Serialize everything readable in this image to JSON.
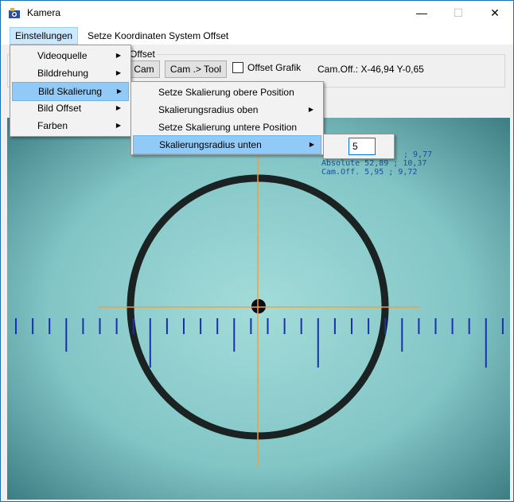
{
  "window": {
    "title": "Kamera",
    "minimize": "—",
    "maximize": "☐",
    "close": "✕"
  },
  "menubar": {
    "items": [
      {
        "label": "Einstellungen"
      },
      {
        "label": "Setze Koordinaten System Offset"
      }
    ]
  },
  "toolbar": {
    "group_label": "Offset",
    "cam_button": "Cam",
    "cam_tool_button": "Cam .> Tool",
    "offset_grafik_label": "Offset Grafik",
    "offset_grafik_checked": false,
    "cam_offset_text": "Cam.Off.: X-46,94 Y-0,65"
  },
  "dropdown_main": {
    "items": [
      {
        "label": "Videoquelle",
        "has_submenu": true
      },
      {
        "label": "Bilddrehung",
        "has_submenu": true
      },
      {
        "label": "Bild Skalierung",
        "has_submenu": true,
        "highlighted": true
      },
      {
        "label": "Bild Offset",
        "has_submenu": true
      },
      {
        "label": "Farben",
        "has_submenu": true
      }
    ]
  },
  "dropdown_sub": {
    "items": [
      {
        "label": "Setze Skalierung obere Position"
      },
      {
        "label": "Skalierungsradius oben",
        "has_submenu": true
      },
      {
        "label": "Setze Skalierung untere Position"
      },
      {
        "label": "Skalierungsradius unten",
        "has_submenu": true,
        "highlighted": true
      }
    ]
  },
  "radius_input": {
    "value": "5"
  },
  "overlay": {
    "line1": "; 9,77",
    "line2": "Absolute 52,89 ; 10,37",
    "line3": "Cam.Off. 5,95 ; 9,72"
  },
  "colors": {
    "camera_bg": "#4a8f94",
    "crosshair": "#f0a040",
    "scale_ticks": "#1a2fb0",
    "ring": "#1a2222"
  },
  "icons": {
    "app": "camera-app-icon",
    "submenu": "chevron-right-icon"
  }
}
